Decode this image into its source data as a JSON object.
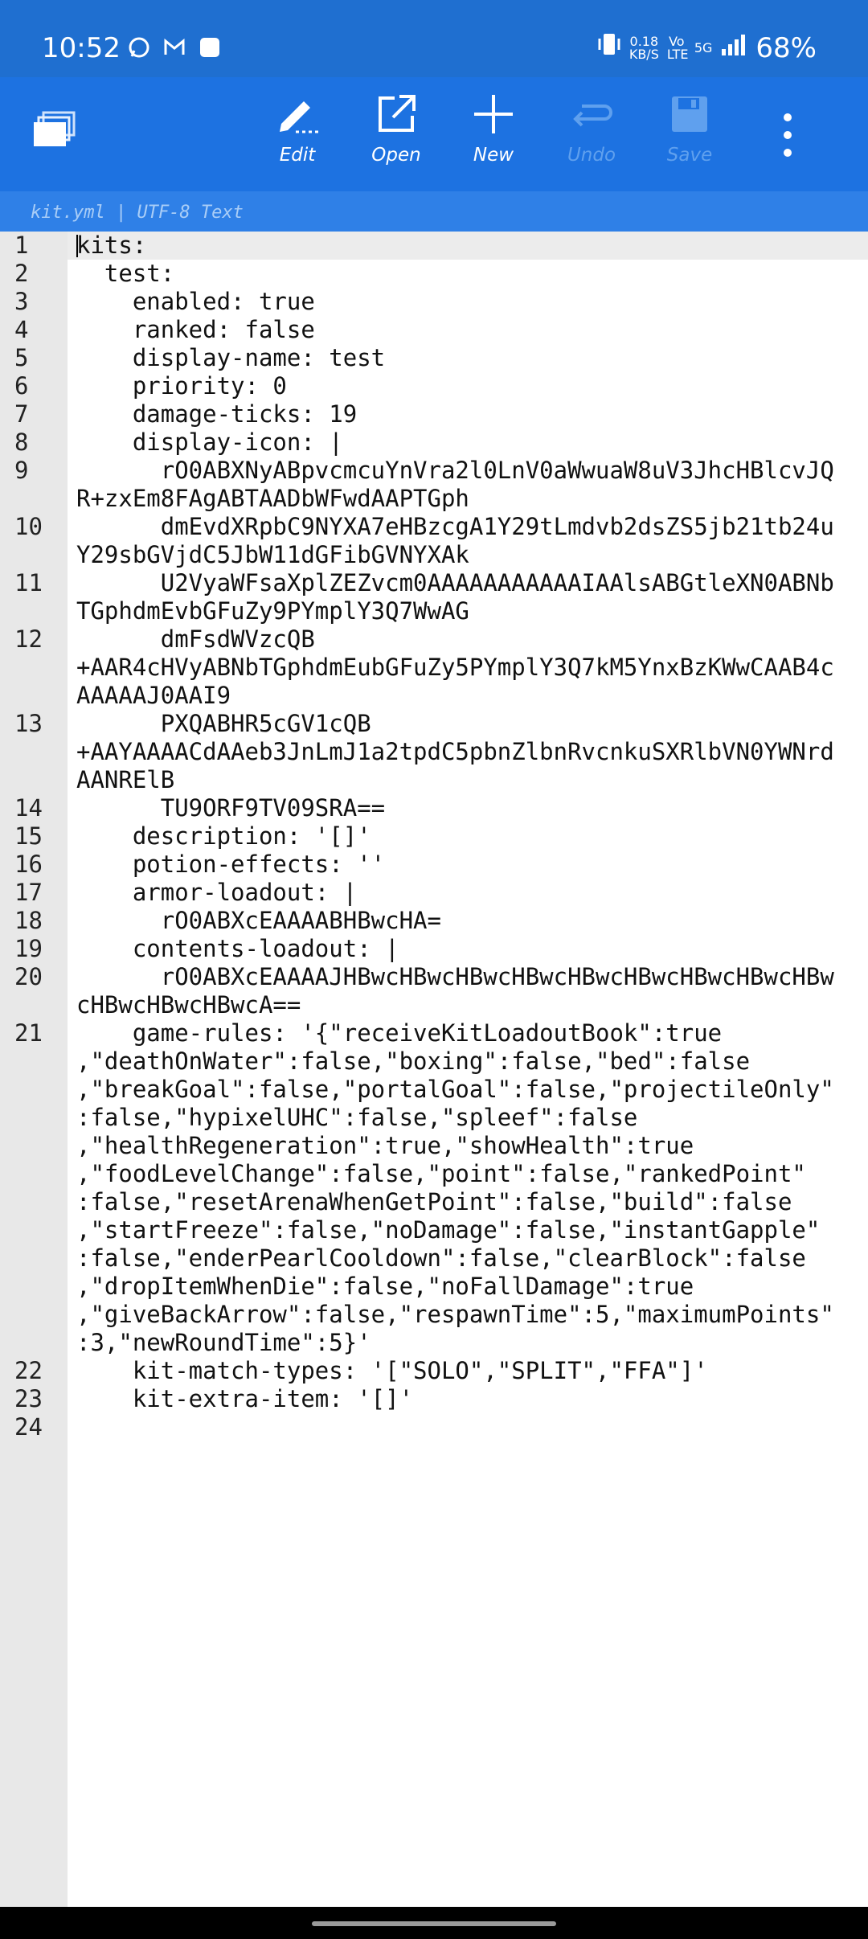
{
  "status": {
    "time": "10:52",
    "net_speed_top": "0.18",
    "net_speed_unit": "KB/S",
    "volte": "Vo LTE",
    "network": "5G",
    "battery": "68%"
  },
  "toolbar": {
    "edit_label": "Edit",
    "open_label": "Open",
    "new_label": "New",
    "undo_label": "Undo",
    "save_label": "Save"
  },
  "filebar": {
    "info": "kit.yml | UTF-8 Text"
  },
  "editor": {
    "lines": [
      {
        "n": "1",
        "t": "kits:"
      },
      {
        "n": "2",
        "t": "  test:"
      },
      {
        "n": "3",
        "t": "    enabled: true"
      },
      {
        "n": "4",
        "t": "    ranked: false"
      },
      {
        "n": "5",
        "t": "    display-name: test"
      },
      {
        "n": "6",
        "t": "    priority: 0"
      },
      {
        "n": "7",
        "t": "    damage-ticks: 19"
      },
      {
        "n": "8",
        "t": "    display-icon: |"
      },
      {
        "n": "9",
        "t": "      rO0ABXNyABpvcmcuYnVra2l0LnV0aWwuaW8uV3JhcHBlcvJQ"
      },
      {
        "n": "",
        "t": "R+zxEm8FAgABTAADbWFwdAAPTGph"
      },
      {
        "n": "10",
        "t": "      dmEvdXRpbC9NYXA7eHBzcgA1Y29tLmdvb2dsZS5jb21tb24u"
      },
      {
        "n": "",
        "t": "Y29sbGVjdC5JbW11dGFibGVNYXAk"
      },
      {
        "n": "11",
        "t": "      U2VyaWFsaXplZEZvcm0AAAAAAAAAAAIAAlsABGtleXN0ABNb"
      },
      {
        "n": "",
        "t": "TGphdmEvbGFuZy9PYmplY3Q7WwAG"
      },
      {
        "n": "12",
        "t": "      dmFsdWVzcQB"
      },
      {
        "n": "",
        "t": "+AAR4cHVyABNbTGphdmEubGFuZy5PYmplY3Q7kM5YnxBzKWwCAAB4c"
      },
      {
        "n": "",
        "t": "AAAAAJ0AAI9"
      },
      {
        "n": "13",
        "t": "      PXQABHR5cGV1cQB"
      },
      {
        "n": "",
        "t": "+AAYAAAACdAAeb3JnLmJ1a2tpdC5pbnZlbnRvcnkuSXRlbVN0YWNrd"
      },
      {
        "n": "",
        "t": "AANRElB"
      },
      {
        "n": "14",
        "t": "      TU9ORF9TV09SRA=="
      },
      {
        "n": "15",
        "t": "    description: '[]'"
      },
      {
        "n": "16",
        "t": "    potion-effects: ''"
      },
      {
        "n": "17",
        "t": "    armor-loadout: |"
      },
      {
        "n": "18",
        "t": "      rO0ABXcEAAAABHBwcHA="
      },
      {
        "n": "19",
        "t": "    contents-loadout: |"
      },
      {
        "n": "20",
        "t": "      rO0ABXcEAAAAJHBwcHBwcHBwcHBwcHBwcHBwcHBwcHBwcHBw"
      },
      {
        "n": "",
        "t": "cHBwcHBwcHBwcA=="
      },
      {
        "n": "21",
        "t": "    game-rules: '{\"receiveKitLoadoutBook\":true"
      },
      {
        "n": "",
        "t": ",\"deathOnWater\":false,\"boxing\":false,\"bed\":false"
      },
      {
        "n": "",
        "t": ",\"breakGoal\":false,\"portalGoal\":false,\"projectileOnly\""
      },
      {
        "n": "",
        "t": ":false,\"hypixelUHC\":false,\"spleef\":false"
      },
      {
        "n": "",
        "t": ",\"healthRegeneration\":true,\"showHealth\":true"
      },
      {
        "n": "",
        "t": ",\"foodLevelChange\":false,\"point\":false,\"rankedPoint\""
      },
      {
        "n": "",
        "t": ":false,\"resetArenaWhenGetPoint\":false,\"build\":false"
      },
      {
        "n": "",
        "t": ",\"startFreeze\":false,\"noDamage\":false,\"instantGapple\""
      },
      {
        "n": "",
        "t": ":false,\"enderPearlCooldown\":false,\"clearBlock\":false"
      },
      {
        "n": "",
        "t": ",\"dropItemWhenDie\":false,\"noFallDamage\":true"
      },
      {
        "n": "",
        "t": ",\"giveBackArrow\":false,\"respawnTime\":5,\"maximumPoints\""
      },
      {
        "n": "",
        "t": ":3,\"newRoundTime\":5}'"
      },
      {
        "n": "22",
        "t": "    kit-match-types: '[\"SOLO\",\"SPLIT\",\"FFA\"]'"
      },
      {
        "n": "23",
        "t": "    kit-extra-item: '[]'"
      },
      {
        "n": "24",
        "t": ""
      }
    ]
  }
}
